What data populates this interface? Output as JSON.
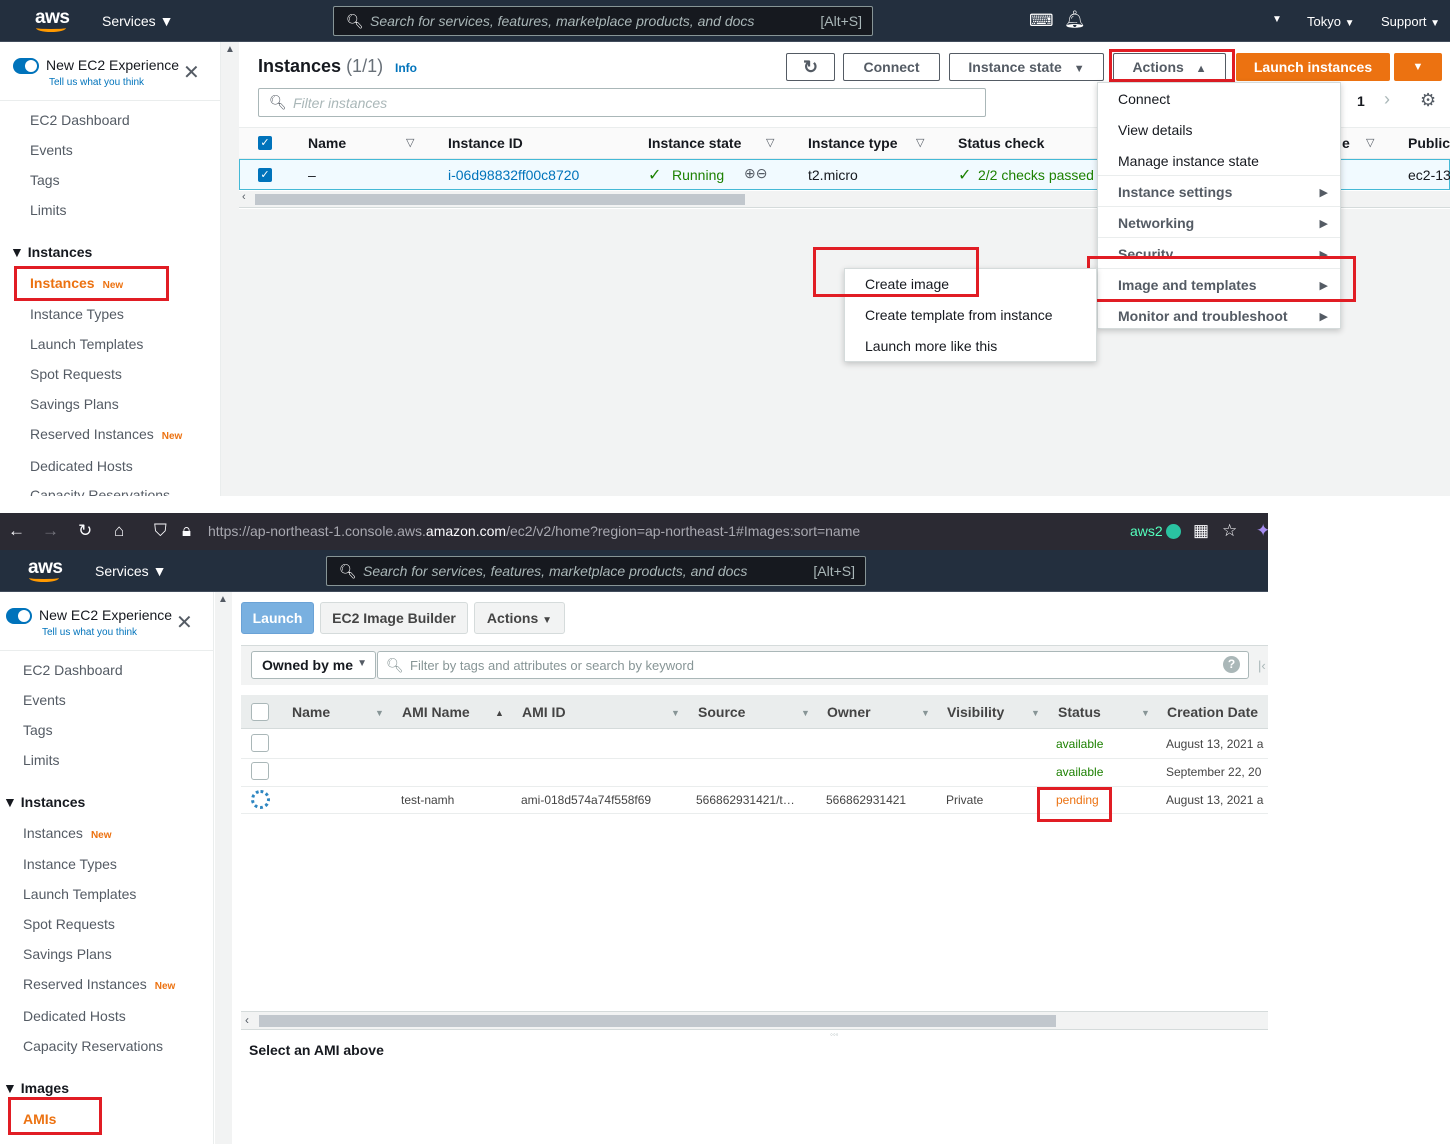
{
  "colors": {
    "accent": "#0073bb",
    "brand_orange": "#ec7211",
    "highlight": "#e11d24",
    "success": "#1d8102"
  },
  "top": {
    "header": {
      "logo": "aws",
      "services": "Services",
      "search_placeholder": "Search for services, features, marketplace products, and docs",
      "search_shortcut": "[Alt+S]",
      "region": "Tokyo",
      "support": "Support"
    },
    "sidebar": {
      "experience_title": "New EC2 Experience",
      "experience_sub": "Tell us what you think",
      "items": [
        "EC2 Dashboard",
        "Events",
        "Tags",
        "Limits"
      ],
      "section": "Instances",
      "active_item": "Instances",
      "new_tag": "New",
      "instance_items": [
        "Instance Types",
        "Launch Templates",
        "Spot Requests",
        "Savings Plans"
      ],
      "reserved": "Reserved Instances",
      "dedicated": "Dedicated Hosts",
      "capacity": "Capacity Reservations"
    },
    "panel": {
      "title": "Instances",
      "count": "(1/1)",
      "info": "Info",
      "connect": "Connect",
      "instance_state": "Instance state",
      "actions": "Actions",
      "launch": "Launch instances",
      "filter_placeholder": "Filter instances",
      "page": "1"
    },
    "table": {
      "headers": [
        "Name",
        "Instance ID",
        "Instance state",
        "Instance type",
        "Status check",
        "Public"
      ],
      "header_partial": "e",
      "row": {
        "name": "–",
        "instance_id": "i-06d98832ff00c8720",
        "state": "Running",
        "type": "t2.micro",
        "status": "2/2 checks passed",
        "public": "ec2-13"
      }
    },
    "actions_menu": [
      "Connect",
      "View details",
      "Manage instance state",
      "Instance settings",
      "Networking",
      "Security",
      "Image and templates",
      "Monitor and troubleshoot"
    ],
    "submenu": [
      "Create image",
      "Create template from instance",
      "Launch more like this"
    ]
  },
  "bottom": {
    "browser": {
      "url_prefix": "https://ap-northeast-1.console.aws.",
      "url_domain": "amazon.com",
      "url_path": "/ec2/v2/home?region=ap-northeast-1#Images:sort=name",
      "profile": "aws2"
    },
    "header": {
      "logo": "aws",
      "services": "Services",
      "search_placeholder": "Search for services, features, marketplace products, and docs",
      "search_shortcut": "[Alt+S]"
    },
    "sidebar": {
      "experience_title": "New EC2 Experience",
      "experience_sub": "Tell us what you think",
      "items": [
        "EC2 Dashboard",
        "Events",
        "Tags",
        "Limits"
      ],
      "section": "Instances",
      "instances": "Instances",
      "new_tag": "New",
      "instance_items": [
        "Instance Types",
        "Launch Templates",
        "Spot Requests",
        "Savings Plans"
      ],
      "reserved": "Reserved Instances",
      "dedicated": "Dedicated Hosts",
      "capacity": "Capacity Reservations",
      "images_section": "Images",
      "amis": "AMIs"
    },
    "toolbar": {
      "launch": "Launch",
      "image_builder": "EC2 Image Builder",
      "actions": "Actions"
    },
    "filter": {
      "owned": "Owned by me",
      "placeholder": "Filter by tags and attributes or search by keyword"
    },
    "table": {
      "headers": [
        "Name",
        "AMI Name",
        "AMI ID",
        "Source",
        "Owner",
        "Visibility",
        "Status",
        "Creation Date"
      ],
      "rows": [
        {
          "name": "",
          "ami_name": "",
          "ami_id": "",
          "source": "",
          "owner": "",
          "visibility": "",
          "status": "available",
          "date": "August 13, 2021 a"
        },
        {
          "name": "",
          "ami_name": "",
          "ami_id": "",
          "source": "",
          "owner": "",
          "visibility": "",
          "status": "available",
          "date": "September 22, 20"
        },
        {
          "name": "",
          "ami_name": "test-namh",
          "ami_id": "ami-018d574a74f558f69",
          "source": "566862931421/t…",
          "owner": "566862931421",
          "visibility": "Private",
          "status": "pending",
          "date": "August 13, 2021 a"
        }
      ]
    },
    "footer": "Select an AMI above"
  }
}
